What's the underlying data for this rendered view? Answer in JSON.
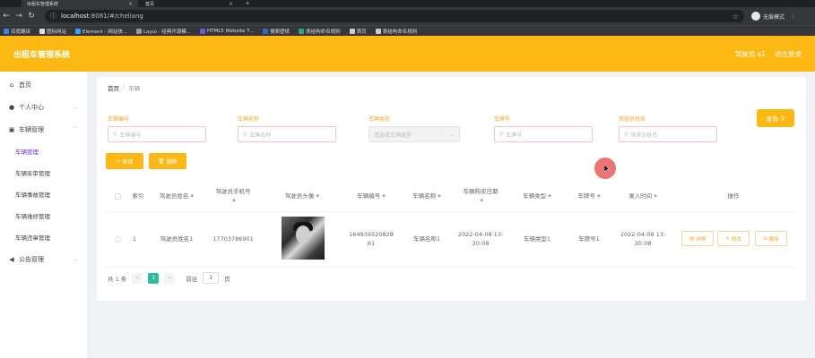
{
  "browser": {
    "tabs": [
      {
        "title": "出租车管理系统",
        "active": true
      },
      {
        "title": "首页",
        "active": false
      }
    ],
    "url_host": "localhost",
    "url_rest": ":8081/#/cheliang",
    "profile_label": "无痕模式",
    "bookmarks": [
      "百度翻译",
      "图标网站",
      "Element - 网站快...",
      "Layui - 经典开源模...",
      "HTML5 Website T...",
      "搜索壁纸",
      "表结构命名规则",
      "首页",
      "表结构命名规则"
    ]
  },
  "header": {
    "title": "出租车管理系统",
    "user": "驾驶员 a1",
    "logout": "退出登录"
  },
  "sidebar": {
    "items": [
      {
        "label": "首页",
        "icon": "home-icon"
      },
      {
        "label": "个人中心",
        "icon": "user-icon"
      },
      {
        "label": "车辆管理",
        "icon": "car-icon"
      },
      {
        "label": "公告管理",
        "icon": "megaphone-icon"
      }
    ],
    "sub_items": [
      {
        "label": "车辆管理",
        "active": true
      },
      {
        "label": "车辆年审管理",
        "active": false
      },
      {
        "label": "车辆事故管理",
        "active": false
      },
      {
        "label": "车辆维修管理",
        "active": false
      },
      {
        "label": "车辆违章管理",
        "active": false
      }
    ]
  },
  "breadcrumb": {
    "home": "首页",
    "separator": "/",
    "current": "车辆"
  },
  "filters": [
    {
      "label": "车辆编号",
      "placeholder": "车辆编号"
    },
    {
      "label": "车辆名称",
      "placeholder": "车辆名称"
    },
    {
      "label": "车辆类型",
      "placeholder": "请选择车辆类型"
    },
    {
      "label": "车牌号",
      "placeholder": "车牌号"
    },
    {
      "label": "驾驶员姓名",
      "placeholder": "驾驶员姓名"
    }
  ],
  "buttons": {
    "query": "查询",
    "add": "新增",
    "delete": "删除"
  },
  "table": {
    "headers": [
      "索引",
      "驾驶员姓名",
      "驾驶员手机号",
      "驾驶员头像",
      "车辆编号",
      "车辆名称",
      "车辆购买日期",
      "车辆类型",
      "车牌号",
      "录入时间",
      "操作"
    ],
    "row": {
      "index": "1",
      "driver_name": "驾驶员姓名1",
      "phone": "17703786901",
      "vehicle_no_1": "164939520828",
      "vehicle_no_2": "61",
      "vehicle_name": "车辆名称1",
      "buy_date_1": "2022-04-08 13:",
      "buy_date_2": "20:08",
      "vehicle_type": "车辆类型1",
      "plate": "车牌号1",
      "entry_1": "2022-04-08 13:",
      "entry_2": "20:08"
    },
    "row_actions": [
      "详情",
      "修改",
      "删除"
    ]
  },
  "pagination": {
    "total": "共 1 条",
    "prev": "<",
    "page": "1",
    "next": ">",
    "goto_label": "前往",
    "goto_value": "1",
    "page_suffix": "页"
  },
  "colors": {
    "accent": "#fdb913",
    "active_menu": "#7a30c8",
    "pager_active": "#2bbf9b"
  }
}
